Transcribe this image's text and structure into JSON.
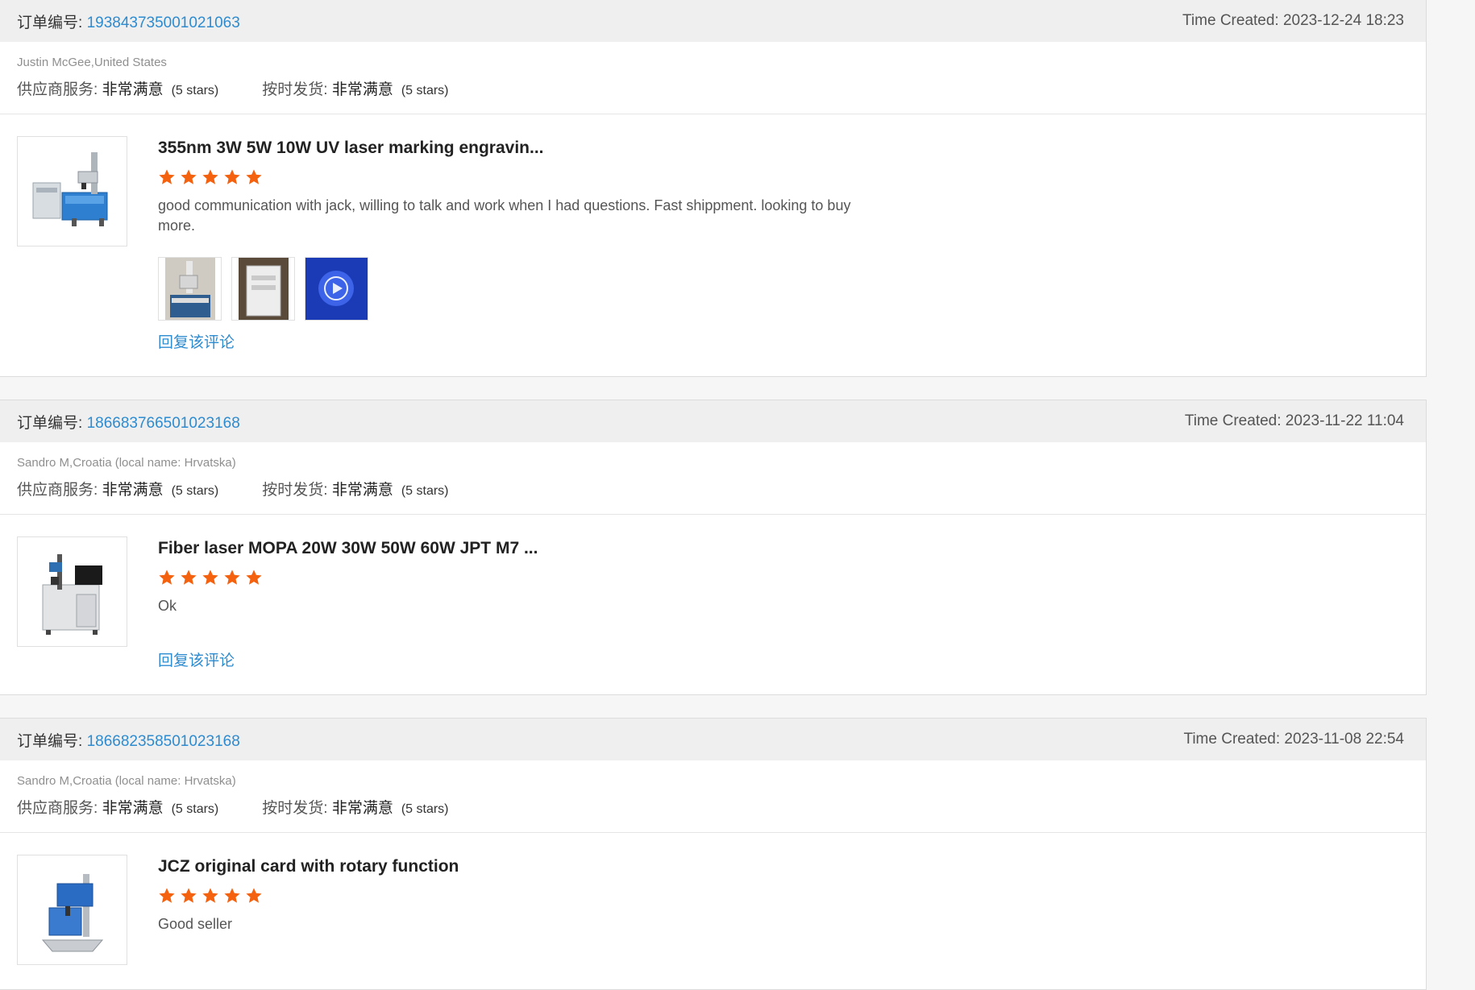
{
  "labels": {
    "order_no": "订单编号:",
    "time_created": "Time Created:",
    "supplier_service": "供应商服务:",
    "on_time_delivery": "按时发货:",
    "reply": "回复该评论"
  },
  "reviews": [
    {
      "order_no": "193843735001021063",
      "time_created": "2023-12-24 18:23",
      "buyer": "Justin McGee,United States",
      "supplier_service_value": "非常满意",
      "supplier_service_stars": "(5 stars)",
      "delivery_value": "非常满意",
      "delivery_stars": "(5 stars)",
      "product_title": "355nm 3W 5W 10W UV laser marking engravin...",
      "rating": 5,
      "comment": "good communication with jack, willing to talk and work when I had questions.  Fast shippment.  looking to buy more."
    },
    {
      "order_no": "186683766501023168",
      "time_created": "2023-11-22 11:04",
      "buyer": "Sandro M,Croatia (local name: Hrvatska)",
      "supplier_service_value": "非常满意",
      "supplier_service_stars": "(5 stars)",
      "delivery_value": "非常满意",
      "delivery_stars": "(5 stars)",
      "product_title": "Fiber laser MOPA 20W 30W 50W 60W JPT M7 ...",
      "rating": 5,
      "comment": "Ok"
    },
    {
      "order_no": "186682358501023168",
      "time_created": "2023-11-08 22:54",
      "buyer": "Sandro M,Croatia (local name: Hrvatska)",
      "supplier_service_value": "非常满意",
      "supplier_service_stars": "(5 stars)",
      "delivery_value": "非常满意",
      "delivery_stars": "(5 stars)",
      "product_title": "JCZ original card with rotary function",
      "rating": 5,
      "comment": "Good seller"
    }
  ],
  "colors": {
    "link": "#2d8bd0",
    "star": "#f5620f",
    "header_bg": "#efefef"
  }
}
